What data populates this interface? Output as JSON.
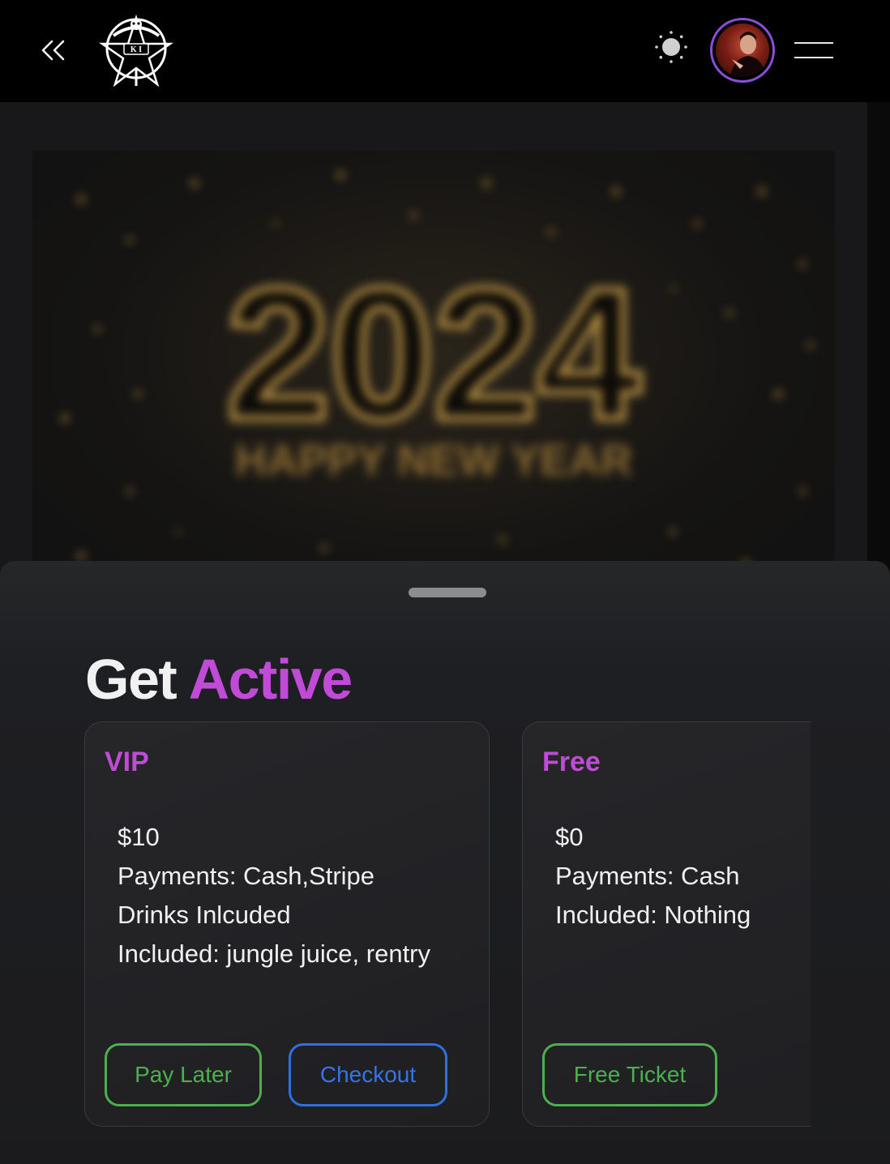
{
  "header": {
    "back_icon": "double-chevron-left-icon",
    "logo": "skull-pentagram-logo",
    "theme_icon": "sun-icon",
    "avatar": "user-avatar",
    "menu_icon": "hamburger-menu-icon"
  },
  "hero": {
    "year": "2024",
    "subtitle": "HAPPY NEW YEAR"
  },
  "sheet": {
    "title_main": "Get",
    "title_accent": "Active",
    "tickets": [
      {
        "name": "VIP",
        "price": "$10",
        "payments": "Payments: Cash,Stripe",
        "drinks": "Drinks Inlcuded",
        "included": "Included: jungle juice, rentry",
        "buttons": [
          "Pay Later",
          "Checkout"
        ]
      },
      {
        "name": "Free",
        "price": "$0",
        "payments": "Payments: Cash",
        "included": "Included: Nothing",
        "buttons": [
          "Free Ticket"
        ]
      }
    ]
  },
  "colors": {
    "accent": "#c04bd6",
    "green": "#4caf50",
    "blue": "#2f6fe0",
    "avatar_ring": "#8a4fd8"
  }
}
